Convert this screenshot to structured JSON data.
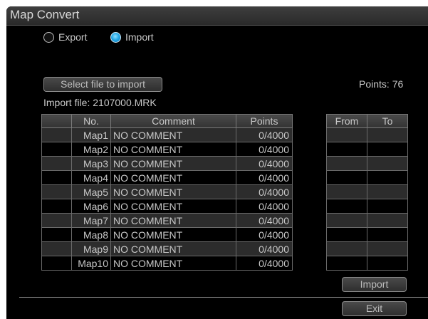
{
  "window": {
    "title": "Map Convert"
  },
  "mode": {
    "options": [
      {
        "label": "Export",
        "selected": false
      },
      {
        "label": "Import",
        "selected": true
      }
    ]
  },
  "file": {
    "select_button": "Select file to import",
    "import_file_label": "Import file: 2107000.MRK",
    "points_label": "Points: 76"
  },
  "map_table": {
    "headers": [
      "",
      "No.",
      "Comment",
      "Points"
    ],
    "rows": [
      {
        "no": "Map1",
        "comment": "NO COMMENT",
        "points": "0/4000"
      },
      {
        "no": "Map2",
        "comment": "NO COMMENT",
        "points": "0/4000"
      },
      {
        "no": "Map3",
        "comment": "NO COMMENT",
        "points": "0/4000"
      },
      {
        "no": "Map4",
        "comment": "NO COMMENT",
        "points": "0/4000"
      },
      {
        "no": "Map5",
        "comment": "NO COMMENT",
        "points": "0/4000"
      },
      {
        "no": "Map6",
        "comment": "NO COMMENT",
        "points": "0/4000"
      },
      {
        "no": "Map7",
        "comment": "NO COMMENT",
        "points": "0/4000"
      },
      {
        "no": "Map8",
        "comment": "NO COMMENT",
        "points": "0/4000"
      },
      {
        "no": "Map9",
        "comment": "NO COMMENT",
        "points": "0/4000"
      },
      {
        "no": "Map10",
        "comment": "NO COMMENT",
        "points": "0/4000"
      }
    ]
  },
  "range_table": {
    "headers": [
      "From",
      "To"
    ]
  },
  "actions": {
    "import_button": "Import",
    "exit_button": "Exit"
  }
}
